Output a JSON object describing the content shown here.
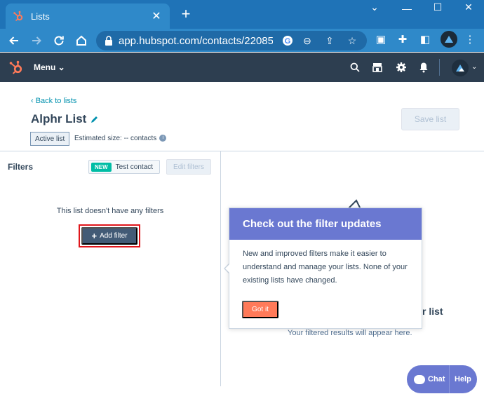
{
  "browser": {
    "tab_title": "Lists",
    "tab_close": "✕",
    "new_tab": "+",
    "url": "app.hubspot.com/contacts/22085...",
    "window_controls": [
      "⌄",
      "—",
      "☐",
      "✕"
    ]
  },
  "nav": {
    "menu_label": "Menu ⌄",
    "icons": [
      "search-icon",
      "marketplace-icon",
      "settings-icon",
      "notifications-icon"
    ],
    "brand_color": "#ff7a59",
    "nav_bg": "#2d3e50"
  },
  "header": {
    "back_link": "‹  Back to lists",
    "title": "Alphr List",
    "save_label": "Save list",
    "status_badge": "Active list",
    "estimated_size": "Estimated size: -- contacts"
  },
  "filters": {
    "title": "Filters",
    "new_badge": "NEW",
    "test_contact": "Test contact",
    "edit_filters": "Edit filters",
    "empty_text": "This list doesn't have any filters",
    "add_filter": "Add filter"
  },
  "results": {
    "heading_partial": "r list",
    "subtext": "Your filtered results will appear here."
  },
  "popover": {
    "title": "Check out the filter updates",
    "body": "New and improved filters make it easier to understand and manage your lists. None of your existing lists have changed.",
    "button": "Got it",
    "accent": "#6a78d1"
  },
  "chat": {
    "chat_label": "Chat",
    "help_label": "Help"
  }
}
